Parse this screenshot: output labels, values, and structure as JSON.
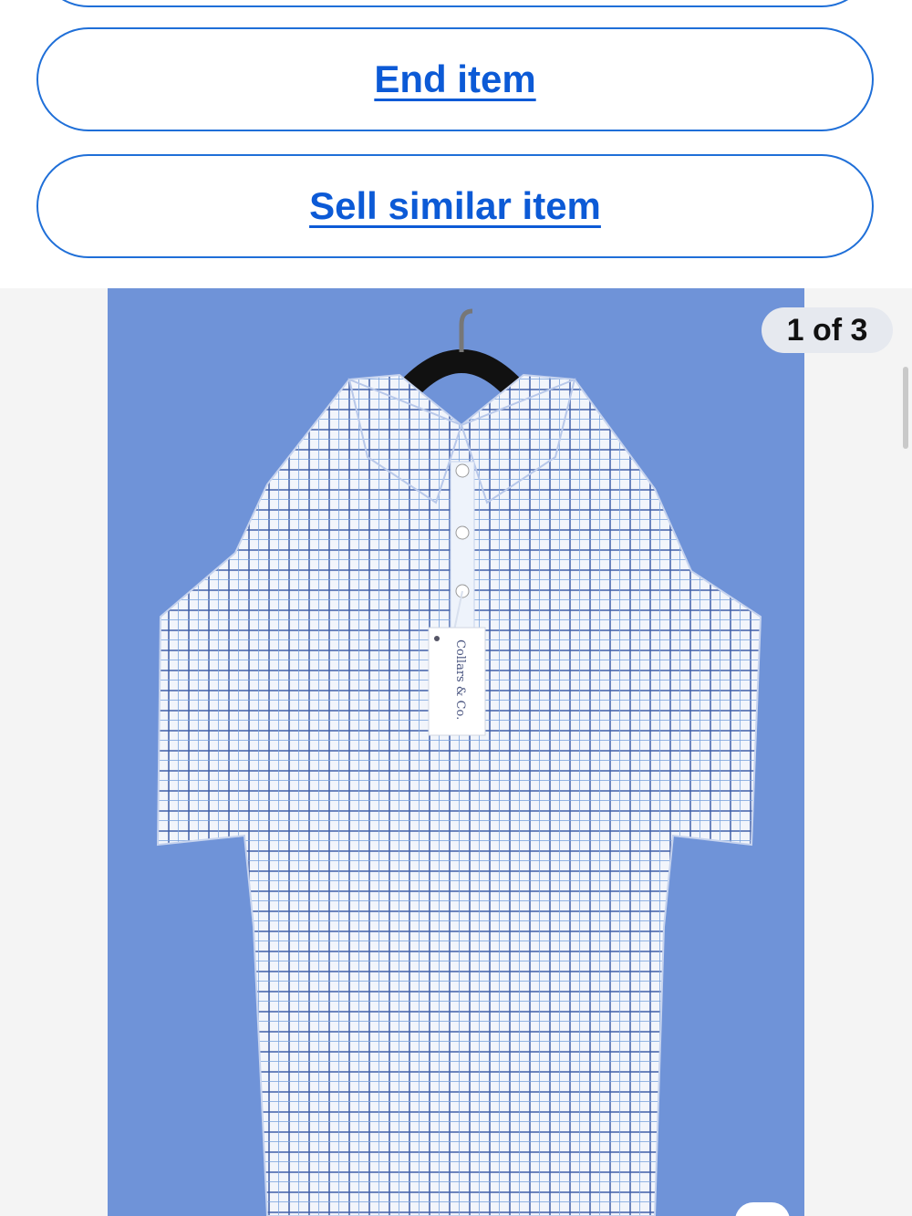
{
  "actions": {
    "end_item": "End item",
    "sell_similar": "Sell similar item"
  },
  "gallery": {
    "counter": "1 of 3",
    "image_label": "Blue checked short-sleeve polo shirt on hanger",
    "hang_tag_text": "Collars & Co."
  },
  "colors": {
    "link_blue": "#0c5ad6",
    "button_border": "#1f6fd8",
    "photo_background": "#6f93d8",
    "gallery_background": "#f4f4f4"
  },
  "icons": {
    "gallery": "product-photo"
  }
}
